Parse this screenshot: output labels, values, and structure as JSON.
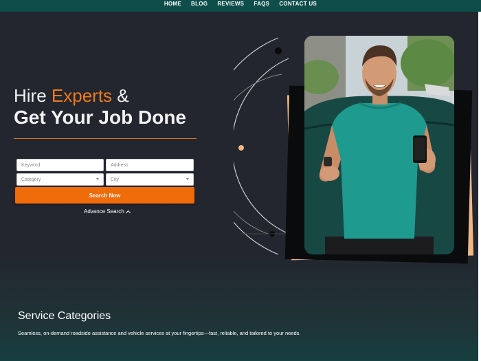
{
  "nav": {
    "items": [
      "HOME",
      "BLOG",
      "REVIEWS",
      "FAQS",
      "CONTACT US"
    ]
  },
  "hero": {
    "title_word1": "Hire",
    "title_accent": "Experts",
    "title_amp": "&",
    "title_line2": "Get Your Job Done"
  },
  "form": {
    "keyword_placeholder": "Keyword",
    "address_placeholder": "Address",
    "category_value": "Category",
    "city_value": "City",
    "search_label": "Search Now",
    "advance_label": "Advance Search"
  },
  "services": {
    "title": "Service Categories",
    "description": "Seamless, on-demand roadside assistance and vehicle services at your fingertips—fast, reliable, and tailored to your needs."
  },
  "colors": {
    "accent": "#f06b0a",
    "nav_bg": "#0e4d4a",
    "page_bg": "#23252f",
    "card_back": "#f0b783"
  },
  "hero_image": {
    "subject": "smiling man in teal t-shirt holding phone and key beside car"
  }
}
